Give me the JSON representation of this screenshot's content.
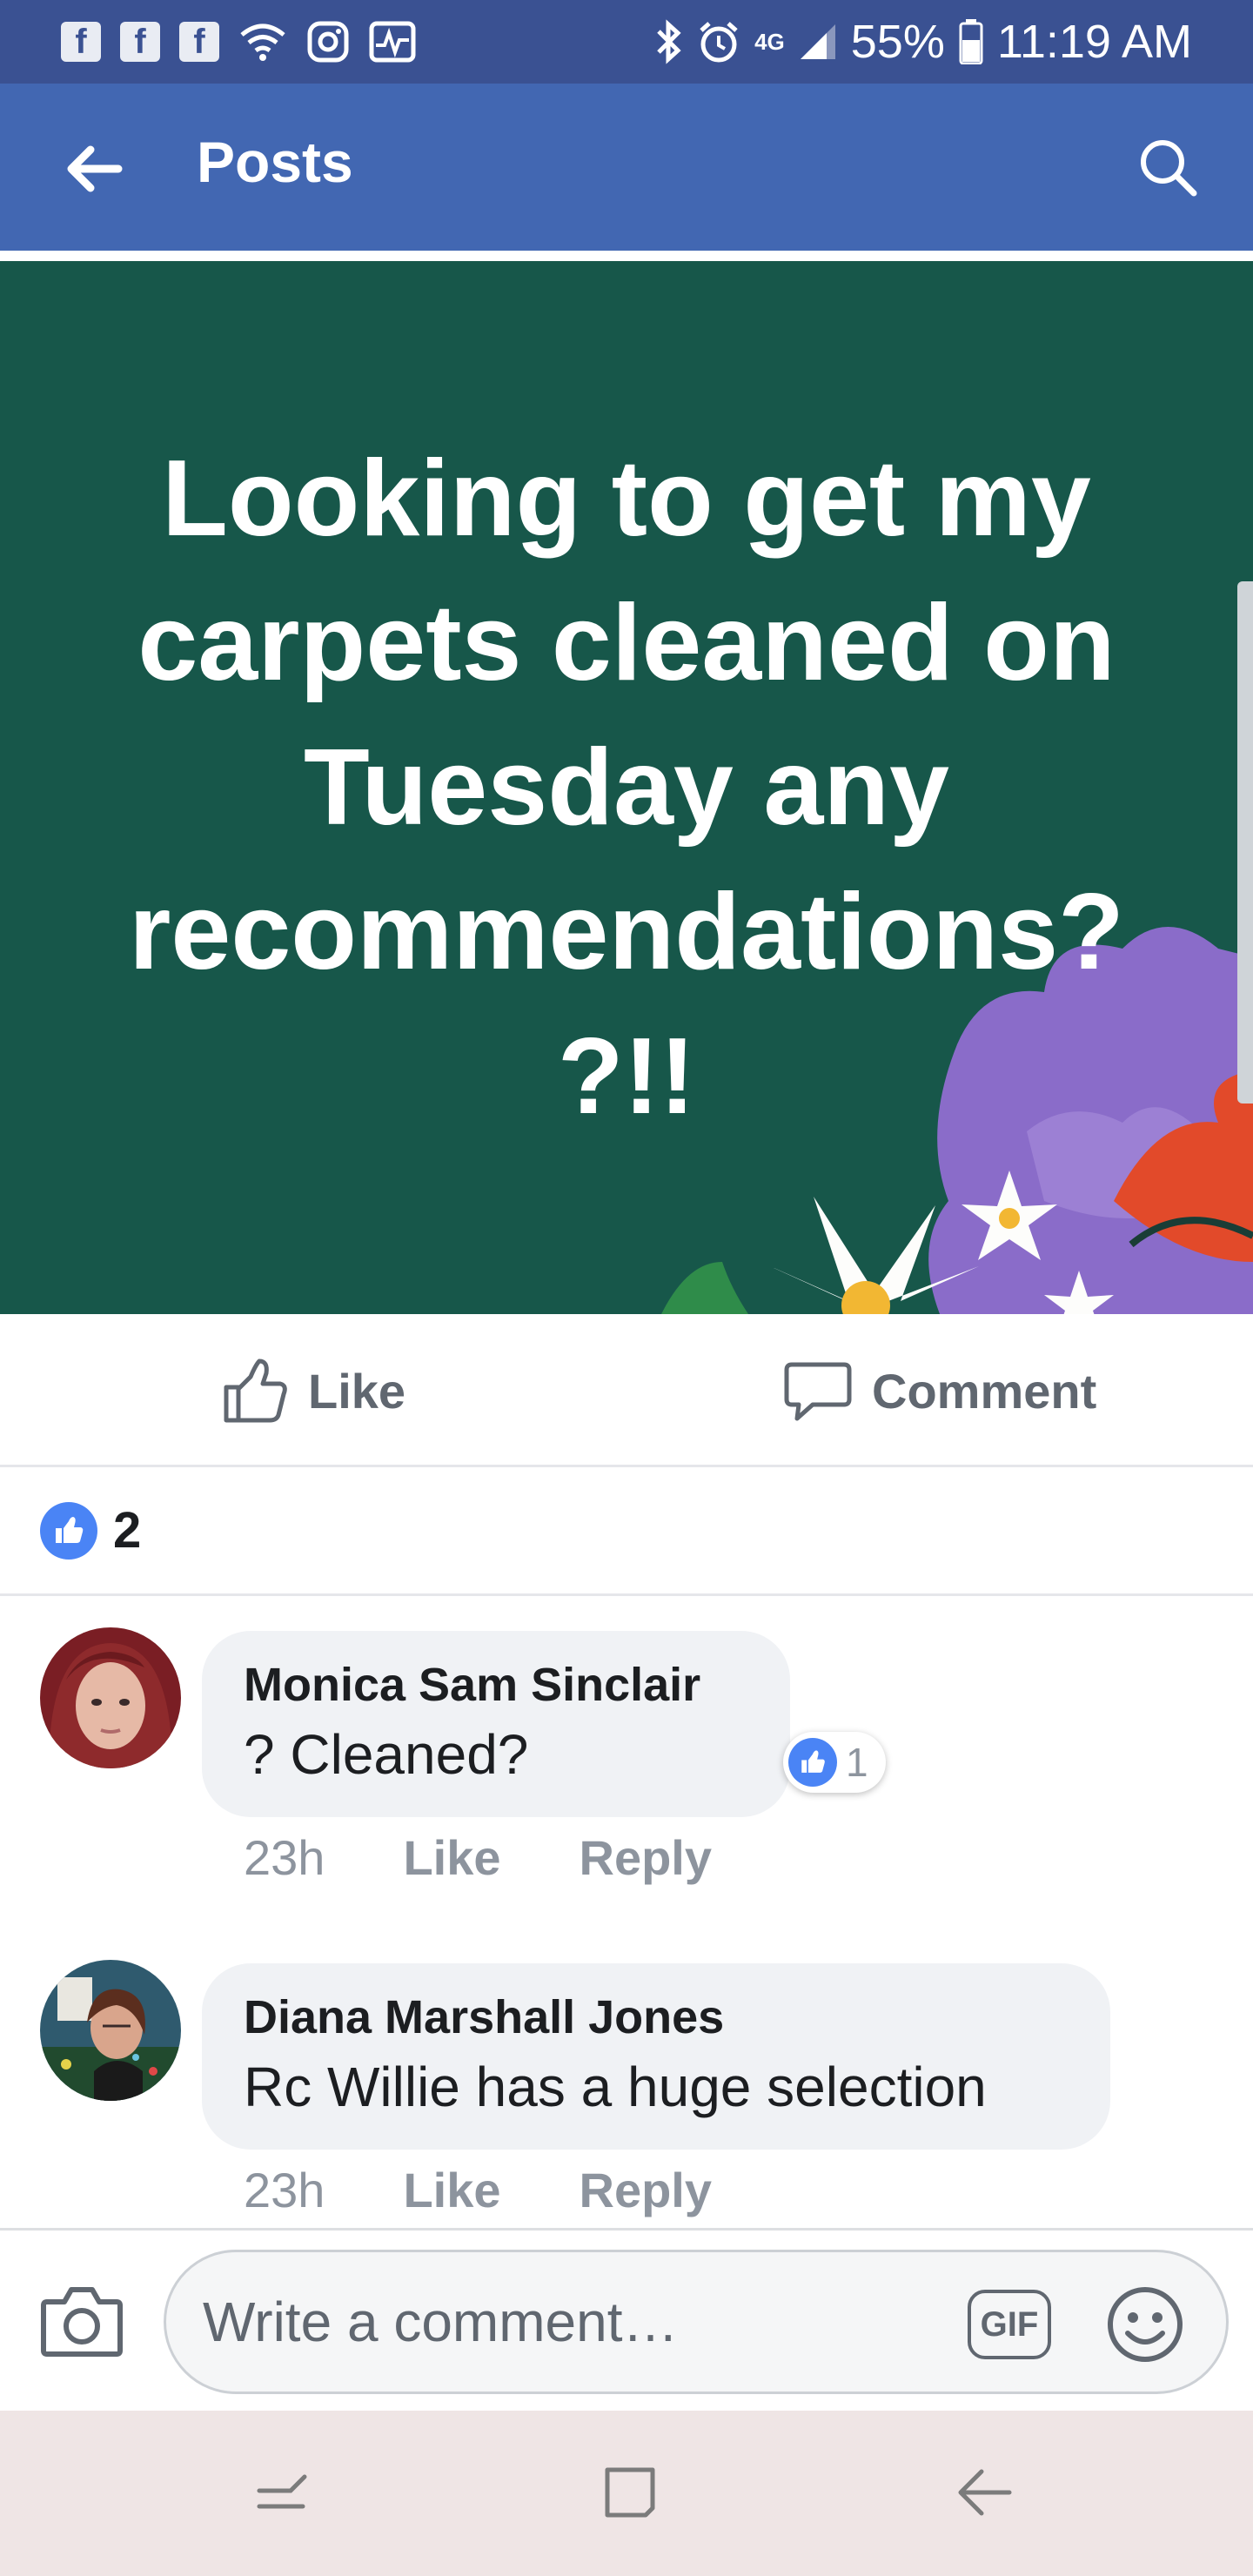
{
  "status_bar": {
    "battery": "55%",
    "time": "11:19 AM",
    "network": "4G"
  },
  "header": {
    "title": "Posts"
  },
  "post": {
    "text": "Looking to get my\ncarpets  cleaned on\nTuesday any\nrecommendations?\n?!!",
    "background_color": "#17574a"
  },
  "actions": {
    "like_label": "Like",
    "comment_label": "Comment"
  },
  "reactions": {
    "count": "2"
  },
  "comments": [
    {
      "author": "Monica Sam Sinclair",
      "text": "? Cleaned?",
      "time": "23h",
      "like_label": "Like",
      "reply_label": "Reply",
      "reaction_count": "1"
    },
    {
      "author": "Diana Marshall Jones",
      "text": "Rc Willie has a huge selection",
      "time": "23h",
      "like_label": "Like",
      "reply_label": "Reply"
    }
  ],
  "composer": {
    "placeholder": "Write a comment…",
    "gif_label": "GIF"
  },
  "colors": {
    "header_blue": "#4267b2",
    "status_blue": "#3a5192",
    "like_blue": "#4a84f5"
  }
}
